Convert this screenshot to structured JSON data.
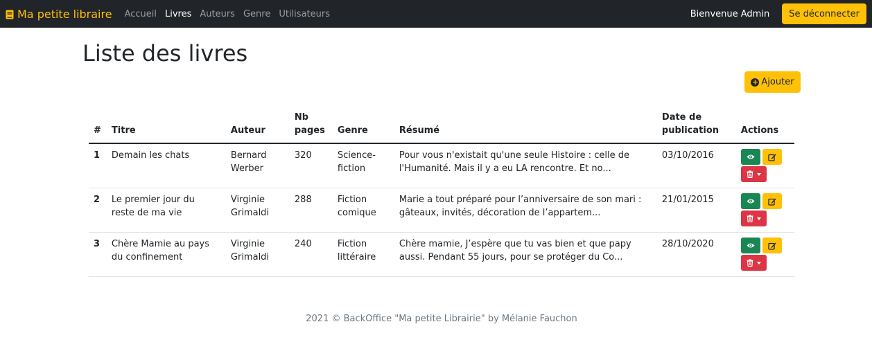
{
  "navbar": {
    "brand": "Ma petite libraire",
    "links": [
      "Accueil",
      "Livres",
      "Auteurs",
      "Genre",
      "Utilisateurs"
    ],
    "active_link": "Livres",
    "welcome": "Bienvenue Admin",
    "logout_label": "Se déconnecter"
  },
  "page": {
    "title": "Liste des livres",
    "add_label": "Ajouter"
  },
  "table": {
    "headers": {
      "num": "#",
      "titre": "Titre",
      "auteur": "Auteur",
      "pages": "Nb pages",
      "genre": "Genre",
      "resume": "Résumé",
      "date": "Date de publication",
      "actions": "Actions"
    },
    "rows": [
      {
        "num": "1",
        "titre": "Demain les chats",
        "auteur": "Bernard Werber",
        "pages": "320",
        "genre": "Science-fiction",
        "resume": "Pour vous n'existait qu'une seule Histoire : celle de l'Humanité. Mais il y a eu LA rencontre. Et no...",
        "date": "03/10/2016"
      },
      {
        "num": "2",
        "titre": "Le premier jour du reste de ma vie",
        "auteur": "Virginie Grimaldi",
        "pages": "288",
        "genre": "Fiction comique",
        "resume": "Marie a tout préparé pour l’anniversaire de son mari : gâteaux, invités, décoration de l’appartem...",
        "date": "21/01/2015"
      },
      {
        "num": "3",
        "titre": "Chère Mamie au pays du confinement",
        "auteur": "Virginie Grimaldi",
        "pages": "240",
        "genre": "Fiction littéraire",
        "resume": "Chère mamie, J’espère que tu vas bien et que papy aussi. Pendant 55 jours, pour se protéger du Co...",
        "date": "28/10/2020"
      }
    ]
  },
  "footer": {
    "text": "2021 © BackOffice \"Ma petite Librairie\" by Mélanie Fauchon"
  },
  "colors": {
    "navbar_bg": "#212529",
    "accent": "#ffc107",
    "view": "#198754",
    "delete": "#dc3545"
  },
  "icons": {
    "brand": "book-icon",
    "add": "plus-circle-icon",
    "view": "eye-icon",
    "edit": "edit-icon",
    "delete": "trash-icon",
    "dropdown": "caret-down-icon"
  }
}
